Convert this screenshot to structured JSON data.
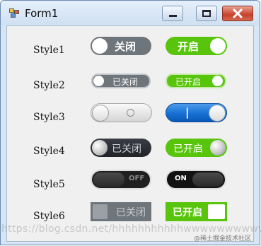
{
  "window": {
    "title": "Form1",
    "accent_color": "#58c50c",
    "on_blue_color": "#1670d4",
    "off_gray_color": "#6e757b"
  },
  "rows": [
    {
      "label": "Style1",
      "off": {
        "text": "关闭"
      },
      "on": {
        "text": "开启"
      }
    },
    {
      "label": "Style2",
      "off": {
        "text": "已关闭"
      },
      "on": {
        "text": "已开启"
      }
    },
    {
      "label": "Style3",
      "off": {
        "text": ""
      },
      "on": {
        "text": "|"
      }
    },
    {
      "label": "Style4",
      "off": {
        "text": "已关闭"
      },
      "on": {
        "text": "已开启"
      }
    },
    {
      "label": "Style5",
      "off": {
        "text": "OFF"
      },
      "on": {
        "text": "ON"
      }
    },
    {
      "label": "Style6",
      "off": {
        "text": "已关闭"
      },
      "on": {
        "text": "已开启"
      }
    }
  ],
  "watermark": "https://blog.csdn.net/hhhhhhhhhhhwwwwwwwwwww",
  "credit": "@稀土掘金技术社区"
}
